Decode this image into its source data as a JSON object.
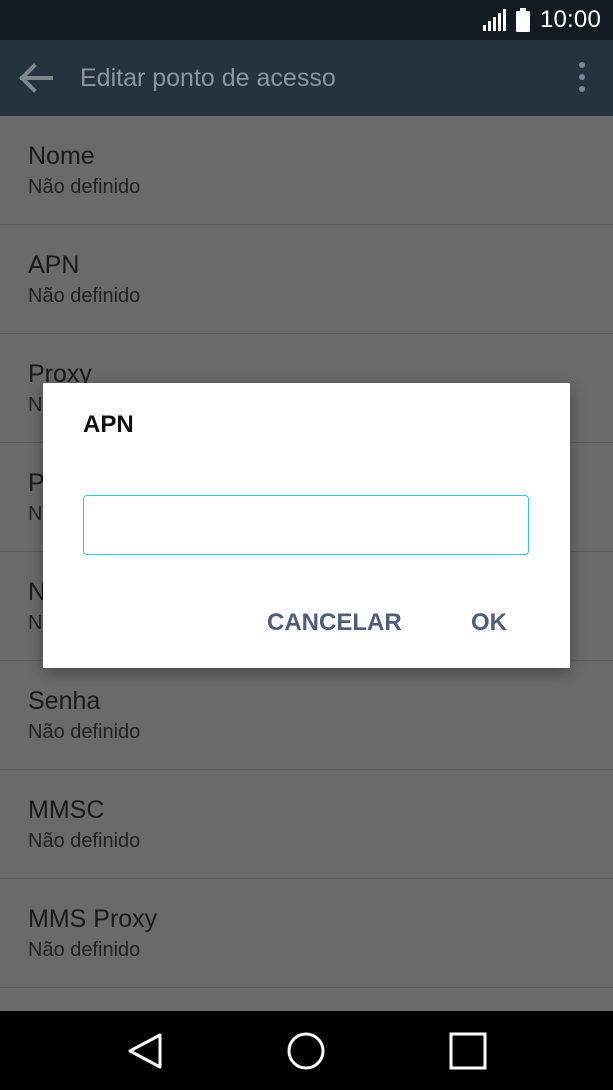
{
  "status_bar": {
    "time": "10:00",
    "icons": [
      "signal-icon",
      "battery-icon"
    ]
  },
  "app_bar": {
    "title": "Editar ponto de acesso",
    "back_icon": "back-arrow-icon",
    "menu_icon": "more-vert-icon"
  },
  "list": {
    "items": [
      {
        "title": "Nome",
        "value": "Não definido"
      },
      {
        "title": "APN",
        "value": "Não definido"
      },
      {
        "title": "Proxy",
        "value": "N"
      },
      {
        "title": "P",
        "value": "N"
      },
      {
        "title": "N",
        "value": "N"
      },
      {
        "title": "Senha",
        "value": "Não definido"
      },
      {
        "title": "MMSC",
        "value": "Não definido"
      },
      {
        "title": "MMS Proxy",
        "value": "Não definido"
      }
    ]
  },
  "dialog": {
    "title": "APN",
    "input_value": "",
    "cancel_label": "CANCELAR",
    "ok_label": "OK"
  },
  "nav_bar": {
    "icons": [
      "back-triangle-icon",
      "home-circle-icon",
      "recents-square-icon"
    ]
  },
  "colors": {
    "accent_input_border": "#2ccfd0",
    "dialog_button_text": "#4c5d79",
    "app_bar_bg": "#27323f"
  }
}
